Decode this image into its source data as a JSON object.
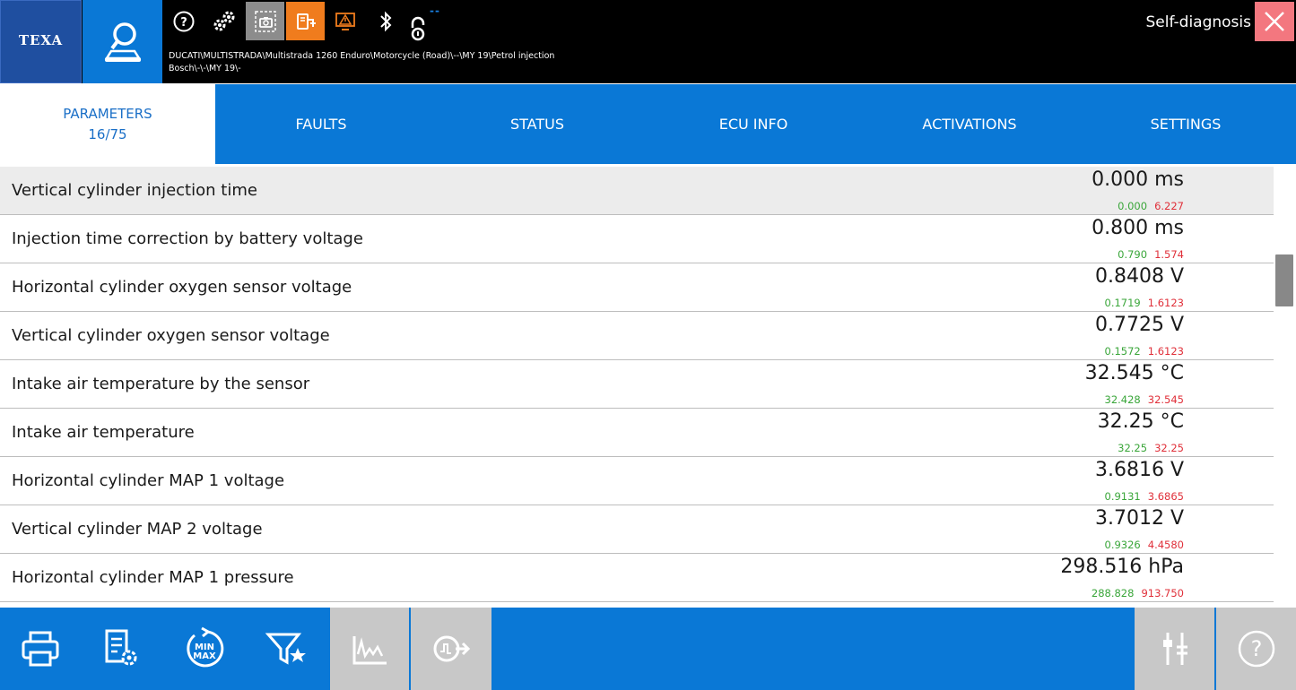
{
  "app": {
    "logo": "TEXA",
    "title": "Self-diagnosis",
    "vehicle_path_line1": "DUCATI\\MULTISTRADA\\Multistrada 1260 Enduro\\Motorcycle (Road)\\--\\MY 19\\Petrol injection",
    "vehicle_path_line2": "Bosch\\-\\-\\MY 19\\-",
    "signal_indicator": "--"
  },
  "toolbar_icons": [
    "help-circle-icon",
    "gears-icon",
    "screenshot-camera-icon",
    "vehicle-connection-icon",
    "warning-triangle-icon",
    "bluetooth-icon",
    "padlock-icon"
  ],
  "tabs": [
    {
      "label": "PARAMETERS",
      "sub": "16/75",
      "active": true
    },
    {
      "label": "FAULTS",
      "sub": "",
      "active": false
    },
    {
      "label": "STATUS",
      "sub": "",
      "active": false
    },
    {
      "label": "ECU INFO",
      "sub": "",
      "active": false
    },
    {
      "label": "ACTIVATIONS",
      "sub": "",
      "active": false
    },
    {
      "label": "SETTINGS",
      "sub": "",
      "active": false
    }
  ],
  "parameters": [
    {
      "name": "Vertical cylinder injection time",
      "value": "0.000 ms",
      "min": "0.000",
      "max": "6.227",
      "selected": true
    },
    {
      "name": "Injection time correction by battery voltage",
      "value": "0.800 ms",
      "min": "0.790",
      "max": "1.574",
      "selected": false
    },
    {
      "name": "Horizontal cylinder oxygen sensor voltage",
      "value": "0.8408 V",
      "min": "0.1719",
      "max": "1.6123",
      "selected": false
    },
    {
      "name": "Vertical cylinder oxygen sensor voltage",
      "value": "0.7725 V",
      "min": "0.1572",
      "max": "1.6123",
      "selected": false
    },
    {
      "name": "Intake air temperature by the sensor",
      "value": "32.545 °C",
      "min": "32.428",
      "max": "32.545",
      "selected": false
    },
    {
      "name": "Intake air temperature",
      "value": "32.25 °C",
      "min": "32.25",
      "max": "32.25",
      "selected": false
    },
    {
      "name": "Horizontal cylinder MAP 1 voltage",
      "value": "3.6816 V",
      "min": "0.9131",
      "max": "3.6865",
      "selected": false
    },
    {
      "name": "Vertical cylinder MAP 2 voltage",
      "value": "3.7012 V",
      "min": "0.9326",
      "max": "4.4580",
      "selected": false
    },
    {
      "name": "Horizontal cylinder MAP 1 pressure",
      "value": "298.516 hPa",
      "min": "288.828",
      "max": "913.750",
      "selected": false
    }
  ],
  "bottom_buttons": [
    {
      "icon": "printer-icon",
      "enabled": true
    },
    {
      "icon": "list-settings-icon",
      "enabled": true
    },
    {
      "icon": "min-max-reset-icon",
      "label": "MIN MAX",
      "enabled": true
    },
    {
      "icon": "filter-star-icon",
      "enabled": true
    },
    {
      "icon": "graph-icon",
      "enabled": false
    },
    {
      "icon": "signal-export-icon",
      "enabled": false
    },
    {
      "icon": "sliders-adjust-icon",
      "enabled": false
    },
    {
      "icon": "help-circle-icon",
      "enabled": false
    }
  ],
  "colors": {
    "accent": "#0a78d6",
    "min_value": "#3aa63a",
    "max_value": "#e0303a",
    "selected_row": "#ececec",
    "close_button": "#f3777f",
    "active_tool": "#f07c1d"
  }
}
